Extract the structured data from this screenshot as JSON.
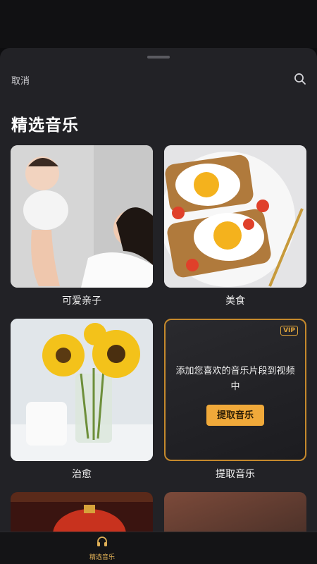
{
  "header": {
    "cancel_label": "取消",
    "search_icon": "search-icon"
  },
  "page": {
    "title": "精选音乐"
  },
  "cards": [
    {
      "label": "可爱亲子"
    },
    {
      "label": "美食"
    },
    {
      "label": "治愈"
    },
    {
      "label": "提取音乐",
      "vip": "VIP",
      "description": "添加您喜欢的音乐片段到视频中",
      "button_label": "提取音乐"
    }
  ],
  "tabbar": {
    "music_label": "精选音乐",
    "music_icon": "headphones-icon"
  },
  "colors": {
    "accent": "#f0a93a",
    "sheet_bg": "#222226",
    "vip": "#e0a53c"
  }
}
